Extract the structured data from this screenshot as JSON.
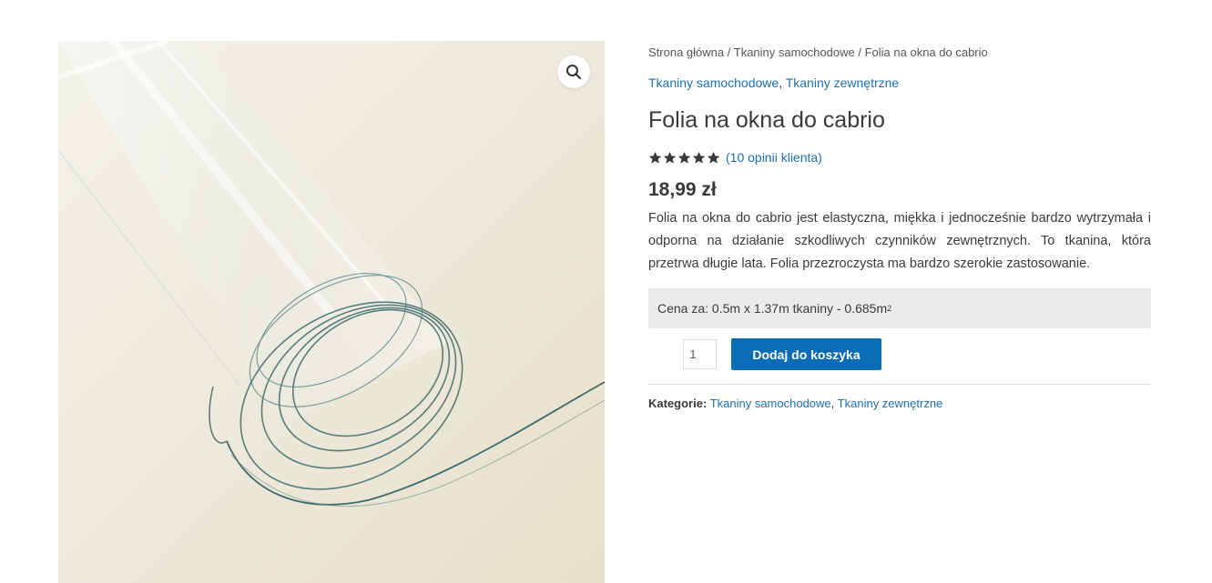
{
  "breadcrumb": {
    "home": "Strona główna",
    "separator": "/",
    "category": "Tkaniny samochodowe",
    "current": "Folia na okna do cabrio"
  },
  "categories_top": {
    "first": "Tkaniny samochodowe",
    "comma": ",",
    "second": "Tkaniny zewnętrzne"
  },
  "product": {
    "title": "Folia na okna do cabrio",
    "rating": 5,
    "rating_max": 5,
    "reviews_label": "(10 opinii klienta)",
    "price": "18,99 zł",
    "description": "Folia na okna do cabrio jest elastyczna, miękka i jednocześnie bardzo wytrzymała i odporna na działanie szkodliwych czynników zewnętrznych. To tkanina, która przetrwa długie lata. Folia przezroczysta ma bardzo szerokie zastosowanie.",
    "price_note": "Cena za: 0.5m x 1.37m tkaniny - 0.685m",
    "price_note_sup": "2"
  },
  "cart": {
    "quantity": "1",
    "add_label": "Dodaj do koszyka"
  },
  "meta": {
    "label": "Kategorie:",
    "first": "Tkaniny samochodowe",
    "comma": ",",
    "second": "Tkaniny zewnętrzne"
  },
  "icons": {
    "zoom": "magnifier-icon",
    "star": "star-icon"
  },
  "colors": {
    "link": "#1e6fb0",
    "button": "#0a6cb5",
    "notice_bg": "#ebebeb",
    "star": "#3a3a3a"
  }
}
